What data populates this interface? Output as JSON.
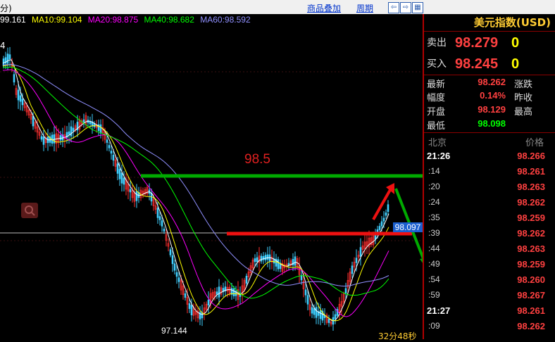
{
  "header": {
    "tab_overlay": "商品叠加",
    "tab_period": "周期",
    "corner_label": "分)",
    "nav_left": "⇦",
    "nav_right": "⇨",
    "nav_grid": "▦"
  },
  "ma_legend": [
    {
      "label": "99.161",
      "color": "#ffffff"
    },
    {
      "label": "MA10:99.104",
      "color": "#ffff00"
    },
    {
      "label": "MA20:98.875",
      "color": "#ff00ff"
    },
    {
      "label": "MA40:98.682",
      "color": "#00ff00"
    },
    {
      "label": "MA60:98.592",
      "color": "#9090ff"
    }
  ],
  "chart_annotations": {
    "level_label": "98.5",
    "current_price_tag": "98.097",
    "low_label": "97.144",
    "countdown": "32分48秒",
    "edge_top": "4"
  },
  "right_panel": {
    "title": "美元指数(USD)",
    "sell_label": "卖出",
    "sell_price": "98.279",
    "sell_vol": "0",
    "buy_label": "买入",
    "buy_price": "98.245",
    "buy_vol": "0",
    "quote_rows": [
      {
        "label": "最新",
        "value": "98.262",
        "color": "#ff4040",
        "label2": "涨跌"
      },
      {
        "label": "幅度",
        "value": "0.14%",
        "color": "#ff4040",
        "label2": "昨收"
      },
      {
        "label": "开盘",
        "value": "98.129",
        "color": "#ff4040",
        "label2": "最高"
      },
      {
        "label": "最低",
        "value": "98.098",
        "color": "#00ff00",
        "label2": ""
      }
    ],
    "tick_header_left": "北京",
    "tick_header_right": "价格",
    "ticks": [
      {
        "time": "21:26",
        "price": "98.266",
        "major": true
      },
      {
        "time": ":14",
        "price": "98.261",
        "major": false
      },
      {
        "time": ":20",
        "price": "98.263",
        "major": false
      },
      {
        "time": ":24",
        "price": "98.262",
        "major": false
      },
      {
        "time": ":35",
        "price": "98.259",
        "major": false
      },
      {
        "time": ":39",
        "price": "98.262",
        "major": false
      },
      {
        "time": ":44",
        "price": "98.263",
        "major": false
      },
      {
        "time": ":49",
        "price": "98.259",
        "major": false
      },
      {
        "time": ":54",
        "price": "98.260",
        "major": false
      },
      {
        "time": ":59",
        "price": "98.267",
        "major": false
      },
      {
        "time": "21:27",
        "price": "98.261",
        "major": true
      },
      {
        "time": ":09",
        "price": "98.262",
        "major": false
      }
    ]
  },
  "colors": {
    "up": "#ff4040",
    "down": "#00c0ff",
    "level_green": "#00aa00",
    "level_red": "#ee1111"
  }
}
